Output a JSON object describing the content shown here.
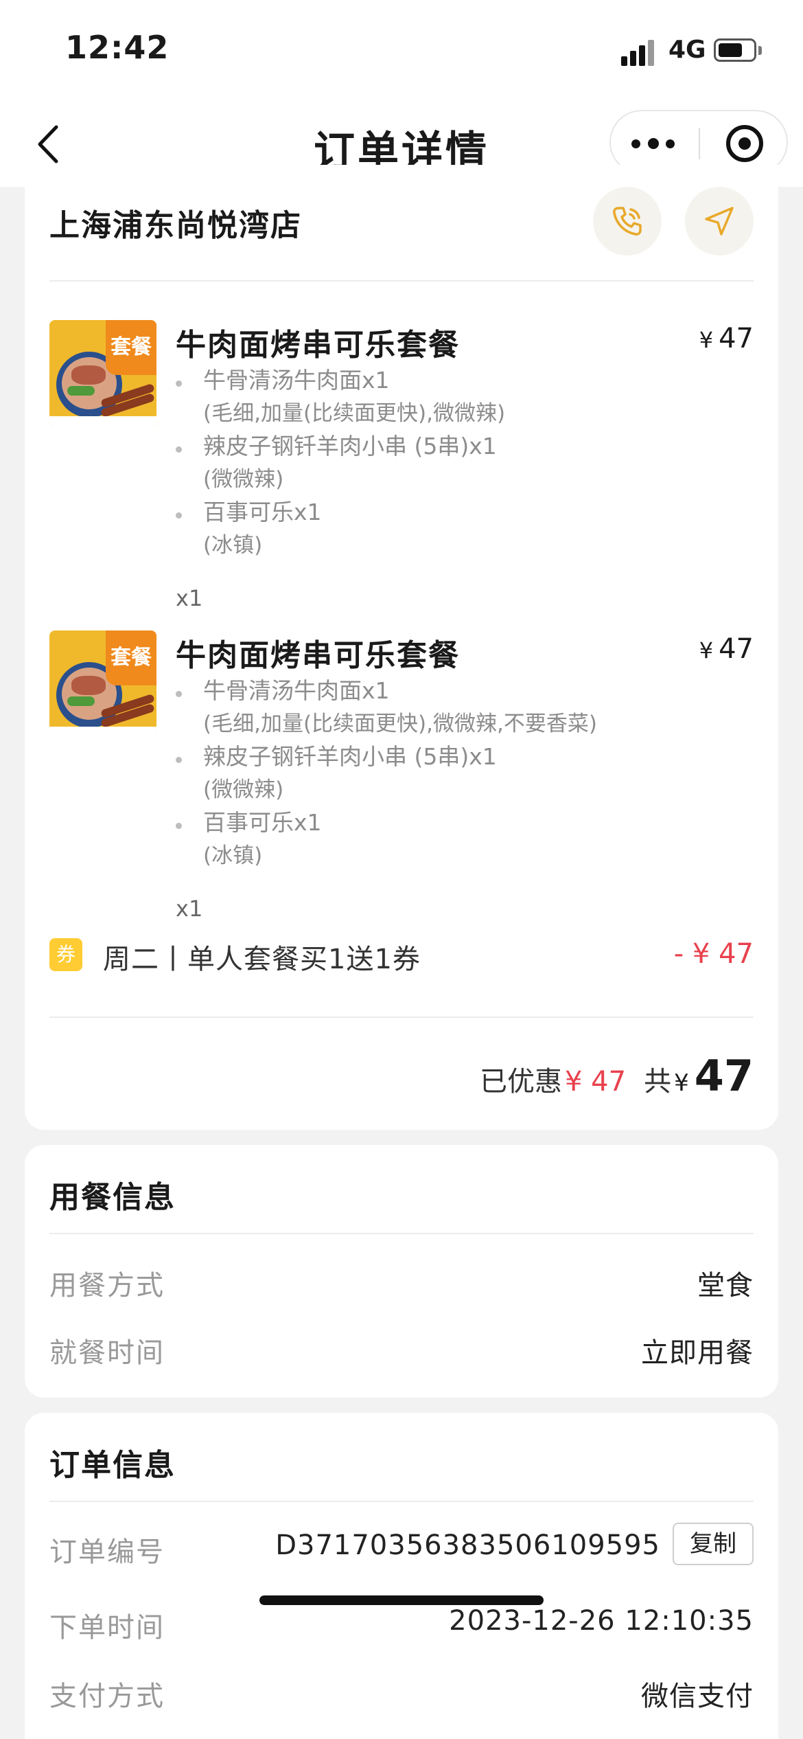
{
  "status_bar": {
    "time": "12:42",
    "network": "4G",
    "battery_level": 0.6
  },
  "nav": {
    "title": "订单详情",
    "icons": [
      "chevron-left-icon",
      "more-icon",
      "target-icon"
    ]
  },
  "store": {
    "name": "上海浦东尚悦湾店",
    "icons": [
      "phone-icon",
      "navigation-icon"
    ]
  },
  "items": [
    {
      "name": "牛肉面烤串可乐套餐",
      "currency": "¥",
      "price": "47",
      "badge": "套餐",
      "components": [
        {
          "name": "牛骨清汤牛肉面x1",
          "spec": "(毛细,加量(比续面更快),微微辣)"
        },
        {
          "name": "辣皮子钢钎羊肉小串 (5串)x1",
          "spec": "(微微辣)"
        },
        {
          "name": "百事可乐x1",
          "spec": "(冰镇)"
        }
      ],
      "quantity": "x1"
    },
    {
      "name": "牛肉面烤串可乐套餐",
      "currency": "¥",
      "price": "47",
      "badge": "套餐",
      "components": [
        {
          "name": "牛骨清汤牛肉面x1",
          "spec": "(毛细,加量(比续面更快),微微辣,不要香菜)"
        },
        {
          "name": "辣皮子钢钎羊肉小串 (5串)x1",
          "spec": "(微微辣)"
        },
        {
          "name": "百事可乐x1",
          "spec": "(冰镇)"
        }
      ],
      "quantity": "x1"
    }
  ],
  "coupon": {
    "badge": "券",
    "label": "周二丨单人套餐买1送1券",
    "value": "- ¥ 47"
  },
  "summary": {
    "discount_label": "已优惠",
    "discount_value": "¥ 47",
    "total_label": "共",
    "total_currency": "¥",
    "total_value": "47"
  },
  "dining_info": {
    "title": "用餐信息",
    "rows": [
      {
        "label": "用餐方式",
        "value": "堂食"
      },
      {
        "label": "就餐时间",
        "value": "立即用餐"
      }
    ]
  },
  "order_info": {
    "title": "订单信息",
    "order_no_label": "订单编号",
    "order_no": "D37170356383506109595",
    "copy_label": "复制",
    "time_label": "下单时间",
    "time_value": "2023-12-26 12:10:35",
    "pay_label": "支付方式",
    "pay_value": "微信支付"
  },
  "colors": {
    "accent_red": "#e8414d",
    "coupon_yellow": "#ffcc33",
    "background": "#f2f2f2"
  }
}
